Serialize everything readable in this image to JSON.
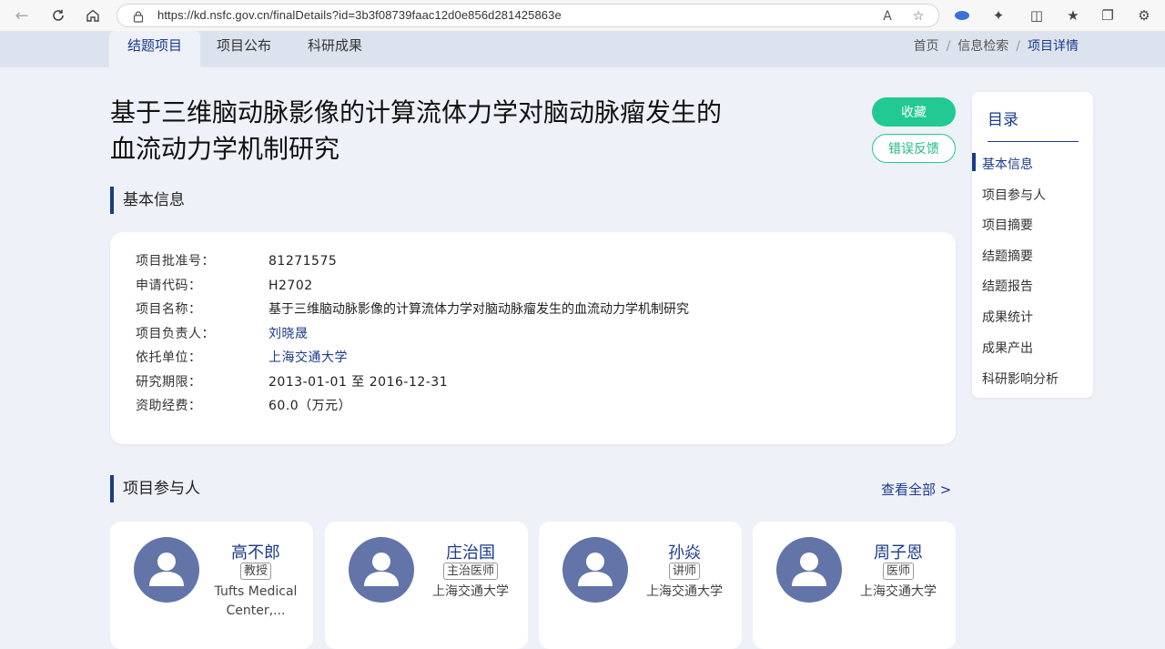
{
  "browser": {
    "url": "https://kd.nsfc.gov.cn/finalDetails?id=3b3f08739faac12d0e856d281425863e"
  },
  "site_tabs": [
    {
      "label": "结题项目",
      "active": true
    },
    {
      "label": "项目公布",
      "active": false
    },
    {
      "label": "科研成果",
      "active": false
    }
  ],
  "breadcrumb": {
    "home": "首页",
    "search": "信息检索",
    "current": "项目详情",
    "separator": "/"
  },
  "project": {
    "title_line1": "基于三维脑动脉影像的计算流体力学对脑动脉瘤发生的",
    "title_line2": "血流动力学机制研究",
    "favorite_label": "收藏",
    "feedback_label": "错误反馈"
  },
  "basic_info": {
    "heading": "基本信息",
    "rows": [
      {
        "label": "项目批准号：",
        "value": "81271575",
        "link": false
      },
      {
        "label": "申请代码：",
        "value": "H2702",
        "link": false
      },
      {
        "label": "项目名称：",
        "value": "基于三维脑动脉影像的计算流体力学对脑动脉瘤发生的血流动力学机制研究",
        "link": false
      },
      {
        "label": "项目负责人：",
        "value": "刘晓晟",
        "link": true
      },
      {
        "label": "依托单位：",
        "value": "上海交通大学",
        "link": true
      },
      {
        "label": "研究期限：",
        "value": "2013-01-01 至 2016-12-31",
        "link": false
      },
      {
        "label": "资助经费：",
        "value": "60.0（万元）",
        "link": false
      }
    ]
  },
  "participants": {
    "heading": "项目参与人",
    "view_all": "查看全部  >",
    "people": [
      {
        "name": "高不郎",
        "role": "教授",
        "org_line1": "Tufts Medical",
        "org_line2": "Center,..."
      },
      {
        "name": "庄治国",
        "role": "主治医师",
        "org_line1": "上海交通大学",
        "org_line2": ""
      },
      {
        "name": "孙焱",
        "role": "讲师",
        "org_line1": "上海交通大学",
        "org_line2": ""
      },
      {
        "name": "周子恩",
        "role": "医师",
        "org_line1": "上海交通大学",
        "org_line2": ""
      }
    ]
  },
  "toc": {
    "title": "目录",
    "items": [
      "基本信息",
      "项目参与人",
      "项目摘要",
      "结题摘要",
      "结题报告",
      "成果统计",
      "成果产出",
      "科研影响分析"
    ],
    "active_index": 0
  },
  "colors": {
    "accent": "#1a3a8a",
    "green": "#22c993",
    "avatar": "#6274a8",
    "page_bg": "#eef1f7"
  }
}
